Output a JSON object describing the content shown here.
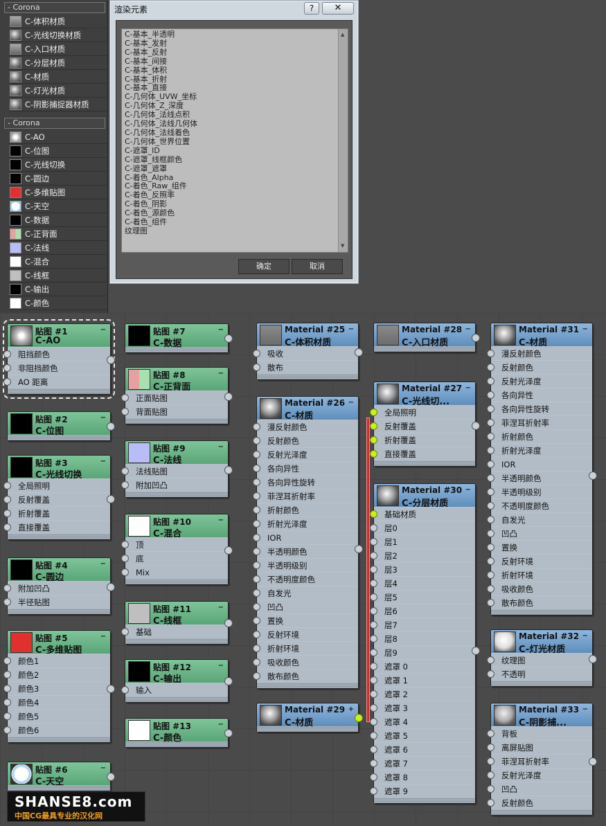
{
  "browser": {
    "section1": "Corona",
    "materials": [
      {
        "label": "C-体积材质",
        "icon": "flat-swatch-icon"
      },
      {
        "label": "C-光线切换材质",
        "icon": "sphere-swatch-icon"
      },
      {
        "label": "C-入口材质",
        "icon": "flat-swatch-icon"
      },
      {
        "label": "C-分层材质",
        "icon": "sphere-swatch-icon"
      },
      {
        "label": "C-材质",
        "icon": "sphere-swatch-icon"
      },
      {
        "label": "C-灯光材质",
        "icon": "sphere-swatch-icon"
      },
      {
        "label": "C-阴影捕捉器材质",
        "icon": "sphere-swatch-icon"
      }
    ],
    "section2": "Corona",
    "maps": [
      {
        "label": "C-AO",
        "color": "#bbbbbb"
      },
      {
        "label": "C-位图",
        "color": "#000000"
      },
      {
        "label": "C-光线切换",
        "color": "#000000"
      },
      {
        "label": "C-圆边",
        "color": "#000000"
      },
      {
        "label": "C-多维贴图",
        "color": "#e03030"
      },
      {
        "label": "C-天空",
        "color": "#ffffff"
      },
      {
        "label": "C-数据",
        "color": "#000000"
      },
      {
        "label": "C-正背面",
        "color": "#dca0a0"
      },
      {
        "label": "C-法线",
        "color": "#b9bdf7"
      },
      {
        "label": "C-混合",
        "color": "#ffffff"
      },
      {
        "label": "C-线框",
        "color": "#bfbfbf"
      },
      {
        "label": "C-输出",
        "color": "#000000"
      },
      {
        "label": "C-颜色",
        "color": "#ffffff"
      }
    ]
  },
  "dialog": {
    "title": "渲染元素",
    "help": "?",
    "close": "✕",
    "items": [
      "C-基本_半透明",
      "C-基本_发射",
      "C-基本_反射",
      "C-基本_间接",
      "C-基本_体积",
      "C-基本_折射",
      "C-基本_直接",
      "C-几何体_UVW_坐标",
      "C-几何体_Z_深度",
      "C-几何体_法线点积",
      "C-几何体_法线几何体",
      "C-几何体_法线着色",
      "C-几何体_世界位置",
      "C-遮罩_ID",
      "C-遮罩_线框颜色",
      "C-遮罩_遮罩",
      "C-着色_Alpha",
      "C-着色_Raw_组件",
      "C-着色_反照率",
      "C-着色_阴影",
      "C-着色_源颜色",
      "C-着色_组件",
      "纹理图"
    ],
    "ok": "确定",
    "cancel": "取消"
  },
  "nodes": {
    "m1": {
      "t1": "贴图 #1",
      "t2": "C-AO",
      "rows": [
        "阻挡颜色",
        "非阻挡颜色",
        "AO 距离"
      ]
    },
    "m2": {
      "t1": "贴图 #2",
      "t2": "C-位图",
      "rows": []
    },
    "m3": {
      "t1": "贴图 #3",
      "t2": "C-光线切换",
      "rows": [
        "全局照明",
        "反射覆盖",
        "折射覆盖",
        "直接覆盖"
      ]
    },
    "m4": {
      "t1": "贴图 #4",
      "t2": "C-圆边",
      "rows": [
        "附加凹凸",
        "半径贴图"
      ]
    },
    "m5": {
      "t1": "贴图 #5",
      "t2": "C-多维贴图",
      "rows": [
        "颜色1",
        "颜色2",
        "颜色3",
        "颜色4",
        "颜色5",
        "颜色6"
      ]
    },
    "m6": {
      "t1": "贴图 #6",
      "t2": "C-天空",
      "rows": []
    },
    "m7": {
      "t1": "贴图 #7",
      "t2": "C-数据",
      "rows": []
    },
    "m8": {
      "t1": "贴图 #8",
      "t2": "C-正背面",
      "rows": [
        "正面贴图",
        "背面贴图"
      ]
    },
    "m9": {
      "t1": "贴图 #9",
      "t2": "C-法线",
      "rows": [
        "法线贴图",
        "附加凹凸"
      ]
    },
    "m10": {
      "t1": "贴图 #10",
      "t2": "C-混合",
      "rows": [
        "顶",
        "底",
        "Mix"
      ]
    },
    "m11": {
      "t1": "贴图 #11",
      "t2": "C-线框",
      "rows": [
        "基础"
      ]
    },
    "m12": {
      "t1": "贴图 #12",
      "t2": "C-输出",
      "rows": [
        "输入"
      ]
    },
    "m13": {
      "t1": "贴图 #13",
      "t2": "C-颜色",
      "rows": []
    },
    "mat25": {
      "t1": "Material #25",
      "t2": "C-体积材质",
      "rows": [
        "吸收",
        "散布"
      ]
    },
    "mat26": {
      "t1": "Material #26",
      "t2": "C-材质",
      "rows": [
        "漫反射颜色",
        "反射颜色",
        "反射光泽度",
        "各向异性",
        "各向异性旋转",
        "菲涅耳折射率",
        "折射颜色",
        "折射光泽度",
        "IOR",
        "半透明颜色",
        "半透明级别",
        "不透明度颜色",
        "自发光",
        "凹凸",
        "置换",
        "反射环境",
        "折射环境",
        "吸收颜色",
        "散布颜色"
      ]
    },
    "mat29": {
      "t1": "Material #29",
      "t2": "C-材质",
      "rows": [],
      "mini": "+"
    },
    "mat28": {
      "t1": "Material #28",
      "t2": "C-入口材质",
      "rows": []
    },
    "mat27": {
      "t1": "Material #27",
      "t2": "C-光线切...",
      "rows": [
        "全局照明",
        "反射覆盖",
        "折射覆盖",
        "直接覆盖"
      ]
    },
    "mat30": {
      "t1": "Material #30",
      "t2": "C-分层材质",
      "rows": [
        "基础材质",
        "层0",
        "层1",
        "层2",
        "层3",
        "层4",
        "层5",
        "层6",
        "层7",
        "层8",
        "层9",
        "遮罩 0",
        "遮罩 1",
        "遮罩 2",
        "遮罩 3",
        "遮罩 4",
        "遮罩 5",
        "遮罩 6",
        "遮罩 7",
        "遮罩 8",
        "遮罩 9"
      ]
    },
    "mat31": {
      "t1": "Material #31",
      "t2": "C-材质",
      "rows": [
        "漫反射颜色",
        "反射颜色",
        "反射光泽度",
        "各向异性",
        "各向异性旋转",
        "菲涅耳折射率",
        "折射颜色",
        "折射光泽度",
        "IOR",
        "半透明颜色",
        "半透明级别",
        "不透明度颜色",
        "自发光",
        "凹凸",
        "置换",
        "反射环境",
        "折射环境",
        "吸收颜色",
        "散布颜色"
      ]
    },
    "mat32": {
      "t1": "Material #32",
      "t2": "C-灯光材质",
      "rows": [
        "纹理图",
        "不透明"
      ]
    },
    "mat33": {
      "t1": "Material #33",
      "t2": "C-阴影捕...",
      "rows": [
        "背板",
        "离屏贴图",
        "菲涅耳折射率",
        "反射光泽度",
        "凹凸",
        "反射颜色"
      ]
    }
  },
  "logo": {
    "line1": "SHANSE8.com",
    "line2": "中国CG最具专业的汉化网"
  }
}
